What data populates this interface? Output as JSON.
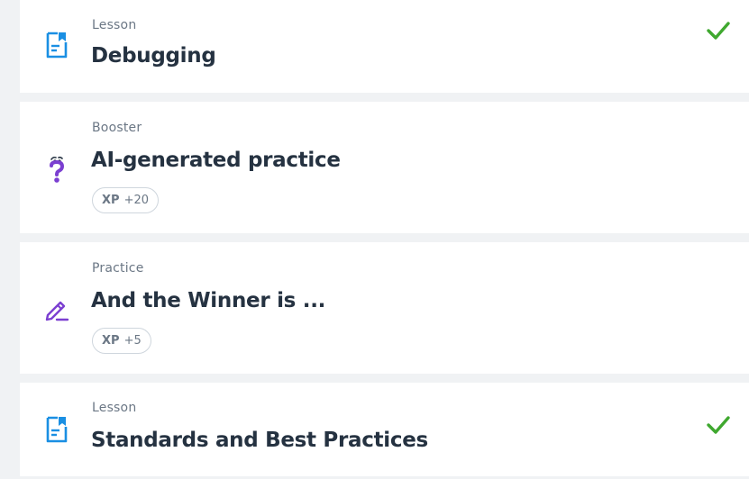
{
  "items": [
    {
      "type": "Lesson",
      "title": "Debugging",
      "icon": "lesson-document-icon",
      "completed": true
    },
    {
      "type": "Booster",
      "title": "AI-generated practice",
      "icon": "question-mark-icon",
      "xp_label": "XP",
      "xp_value": "+20"
    },
    {
      "type": "Practice",
      "title": "And the Winner is ...",
      "icon": "pencil-icon",
      "xp_label": "XP",
      "xp_value": "+5"
    },
    {
      "type": "Lesson",
      "title": "Standards and Best Practices",
      "icon": "lesson-document-icon",
      "completed": true
    }
  ],
  "colors": {
    "lesson_icon": "#1a8fe3",
    "booster_icon": "#7b3fd1",
    "practice_icon": "#7b3fd1",
    "check": "#3fa82f",
    "title": "#253241",
    "type_label": "#6b7785",
    "background": "#f0f2f4"
  }
}
